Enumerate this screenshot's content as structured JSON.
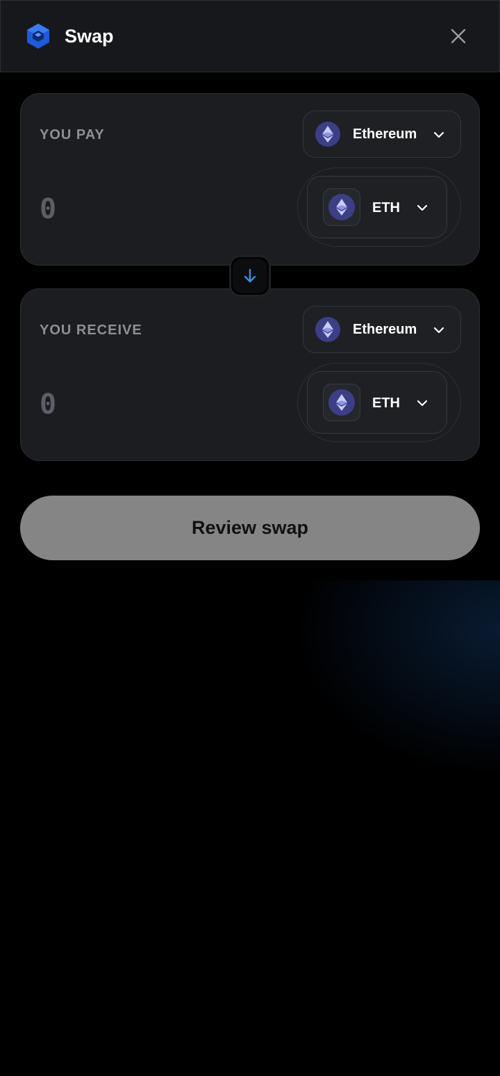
{
  "header": {
    "title": "Swap"
  },
  "pay": {
    "label": "YOU PAY",
    "amount_placeholder": "0",
    "network": {
      "name": "Ethereum",
      "icon": "ethereum-icon"
    },
    "token": {
      "symbol": "ETH",
      "icon": "ethereum-icon"
    }
  },
  "receive": {
    "label": "YOU RECEIVE",
    "amount_placeholder": "0",
    "network": {
      "name": "Ethereum",
      "icon": "ethereum-icon"
    },
    "token": {
      "symbol": "ETH",
      "icon": "ethereum-icon"
    }
  },
  "actions": {
    "review_label": "Review swap"
  },
  "colors": {
    "background": "#000000",
    "panel": "#1b1d21",
    "accent_blue": "#3b8fe8",
    "coin_badge": "#3c3f86",
    "review_button": "#858585"
  }
}
